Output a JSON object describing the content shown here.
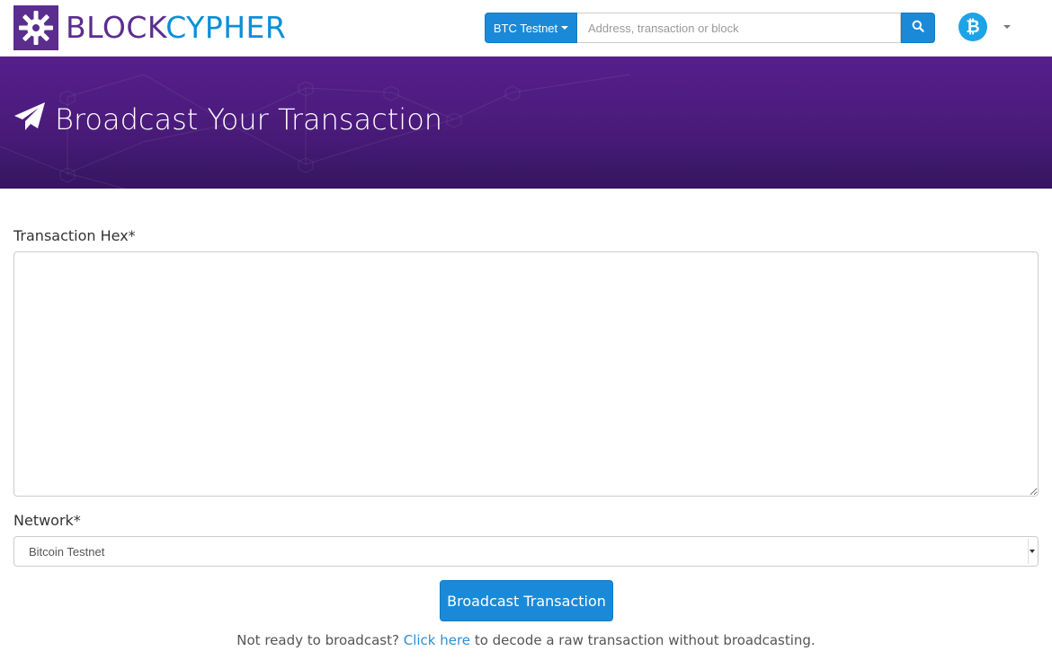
{
  "brand": {
    "name_part1": "BLOCK",
    "name_part2": "CYPHER",
    "logo_icon": "blockcypher-gear-icon",
    "colors": {
      "purple": "#5b2d8e",
      "blue": "#0a8fd8"
    }
  },
  "header": {
    "network_button_label": "BTC Testnet",
    "search_placeholder": "Address, transaction or block",
    "search_icon": "search-icon",
    "coin_icon_glyph": "₿",
    "coin_icon": "bitcoin-icon"
  },
  "hero": {
    "title": "Broadcast Your Transaction",
    "icon": "paper-plane-icon",
    "background": "#4a1b7a"
  },
  "form": {
    "hex_label": "Transaction Hex*",
    "hex_value": "",
    "network_label": "Network*",
    "network_selected": "Bitcoin Testnet",
    "submit_label": "Broadcast Transaction"
  },
  "footnote": {
    "prefix": "Not ready to broadcast?",
    "link_text": "Click here",
    "suffix": "to decode a raw transaction without broadcasting."
  },
  "accent_color": "#1a8ad8"
}
